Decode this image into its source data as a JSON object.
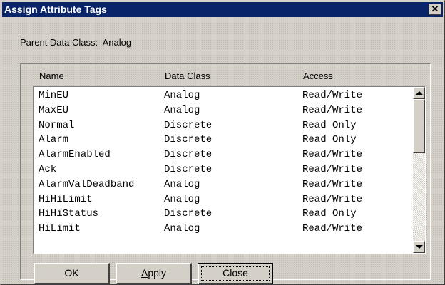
{
  "window": {
    "title": "Assign Attribute Tags",
    "close_glyph": "✕"
  },
  "parent": {
    "label": "Parent Data Class:",
    "value": "Analog"
  },
  "table": {
    "headers": [
      "Name",
      "Data Class",
      "Access"
    ],
    "rows": [
      {
        "name": "MinEU",
        "data_class": "Analog",
        "access": "Read/Write"
      },
      {
        "name": "MaxEU",
        "data_class": "Analog",
        "access": "Read/Write"
      },
      {
        "name": "Normal",
        "data_class": "Discrete",
        "access": "Read Only"
      },
      {
        "name": "Alarm",
        "data_class": "Discrete",
        "access": "Read Only"
      },
      {
        "name": "AlarmEnabled",
        "data_class": "Discrete",
        "access": "Read/Write"
      },
      {
        "name": "Ack",
        "data_class": "Discrete",
        "access": "Read/Write"
      },
      {
        "name": "AlarmValDeadband",
        "data_class": "Analog",
        "access": "Read/Write"
      },
      {
        "name": "HiHiLimit",
        "data_class": "Analog",
        "access": "Read/Write"
      },
      {
        "name": "HiHiStatus",
        "data_class": "Discrete",
        "access": "Read Only"
      },
      {
        "name": "HiLimit",
        "data_class": "Analog",
        "access": "Read/Write"
      }
    ]
  },
  "buttons": {
    "ok": "OK",
    "apply_first": "A",
    "apply_rest": "pply",
    "close": "Close"
  },
  "colors": {
    "titlebar": "#0a246a",
    "face": "#d4d0c8"
  }
}
